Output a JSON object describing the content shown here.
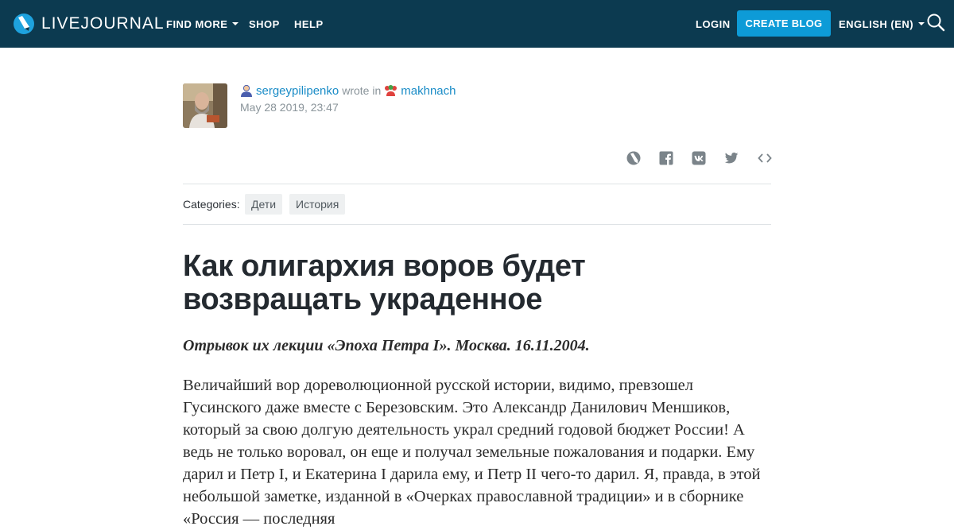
{
  "header": {
    "logo_text": "LIVEJOURNAL",
    "nav": {
      "find_more": "FIND MORE",
      "shop": "SHOP",
      "help": "HELP",
      "login": "LOGIN",
      "create_blog": "CREATE BLOG",
      "language": "ENGLISH (EN)"
    },
    "colors": {
      "bar": "#0c3a50",
      "accent": "#0d9bd7"
    }
  },
  "post": {
    "author": "sergeypilipenko",
    "wrote_in": "wrote in",
    "community": "makhnach",
    "date": "May 28 2019, 23:47",
    "share_icons": [
      "livejournal-icon",
      "facebook-icon",
      "vk-icon",
      "twitter-icon",
      "embed-icon"
    ],
    "categories_label": "Categories:",
    "categories": [
      "Дети",
      "История"
    ],
    "title": "Как олигархия воров будет возвращать украденное",
    "subtitle": "Отрывок их лекции «Эпоха Петра I». Москва. 16.11.2004.",
    "body": "Величайший вор дореволюционной русской истории, видимо, превзошел Гусинского даже вместе с Березовским. Это Александр Данилович Меншиков, который за свою долгую деятельность украл средний годовой бюджет России! А ведь не только воровал, он еще и получал земельные пожалования и подарки. Ему дарил и Петр I, и Екатерина I дарила ему, и Петр II чего-то дарил. Я, правда, в этой небольшой заметке, изданной в «Очерках православной традиции» и в сборнике «Россия — последняя"
  }
}
